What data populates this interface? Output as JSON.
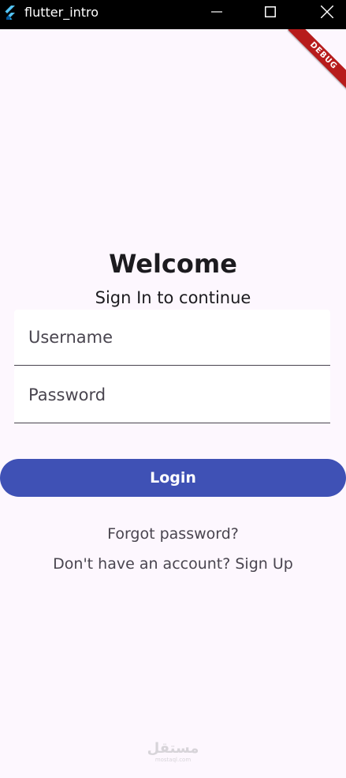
{
  "window": {
    "title": "flutter_intro",
    "logo_icon": "flutter-logo-icon",
    "controls": [
      "minimize-icon",
      "maximize-icon",
      "close-icon"
    ]
  },
  "debug_banner": {
    "label": "DEBUG",
    "color": "#b71c1c"
  },
  "login": {
    "heading": "Welcome",
    "subtitle": "Sign In to continue",
    "username": {
      "placeholder": "Username",
      "value": ""
    },
    "password": {
      "placeholder": "Password",
      "value": ""
    },
    "login_label": "Login",
    "forgot_label": "Forgot password?",
    "signup_label": "Don't have an account? Sign Up"
  },
  "watermark": {
    "arabic": "مستقل",
    "latin": "mostaql.com"
  },
  "colors": {
    "background": "#fdf7fe",
    "primary": "#3f51b5",
    "titlebar": "#000000"
  }
}
